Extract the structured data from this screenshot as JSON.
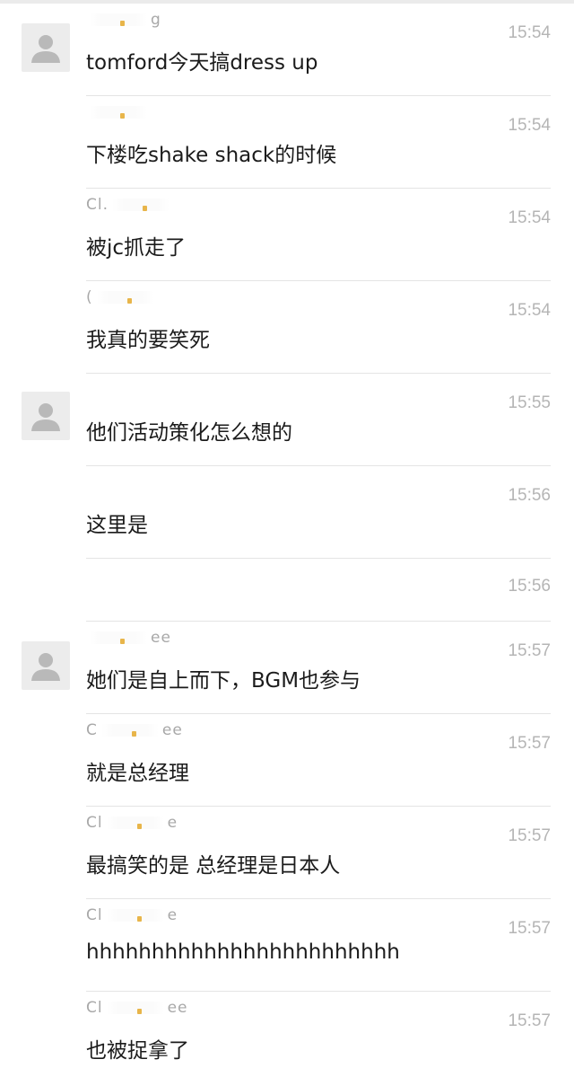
{
  "messages": [
    {
      "name_start": "",
      "name_end": "g",
      "time": "15:54",
      "text": "tomford今天搞dress up",
      "avatar": true
    },
    {
      "name_start": "",
      "name_end": "",
      "time": "15:54",
      "text": "下楼吃shake shack的时候",
      "avatar": false
    },
    {
      "name_start": "Cl.",
      "name_end": "",
      "time": "15:54",
      "text": "被jc抓走了",
      "avatar": false
    },
    {
      "name_start": "(",
      "name_end": "",
      "time": "15:54",
      "text": "我真的要笑死",
      "avatar": false
    },
    {
      "name_start": "",
      "name_end": "",
      "time": "15:55",
      "text": "他们活动策化怎么想的",
      "avatar": true
    },
    {
      "name_start": "",
      "name_end": "",
      "time": "15:56",
      "text": "这里是",
      "avatar": false
    },
    {
      "name_start": "",
      "name_end": "",
      "time": "15:56",
      "text": "",
      "avatar": false
    },
    {
      "name_start": "",
      "name_end": "ee",
      "time": "15:57",
      "text": "她们是自上而下，BGM也参与",
      "avatar": true
    },
    {
      "name_start": "C",
      "name_end": "ee",
      "time": "15:57",
      "text": "就是总经理",
      "avatar": false
    },
    {
      "name_start": "Cl",
      "name_end": "e",
      "time": "15:57",
      "text": "最搞笑的是 总经理是日本人",
      "avatar": false
    },
    {
      "name_start": "Cl",
      "name_end": "e",
      "time": "15:57",
      "text": "hhhhhhhhhhhhhhhhhhhhhhhh",
      "avatar": false
    },
    {
      "name_start": "Cl",
      "name_end": "ee",
      "time": "15:57",
      "text": "也被捉拿了",
      "avatar": false
    }
  ]
}
